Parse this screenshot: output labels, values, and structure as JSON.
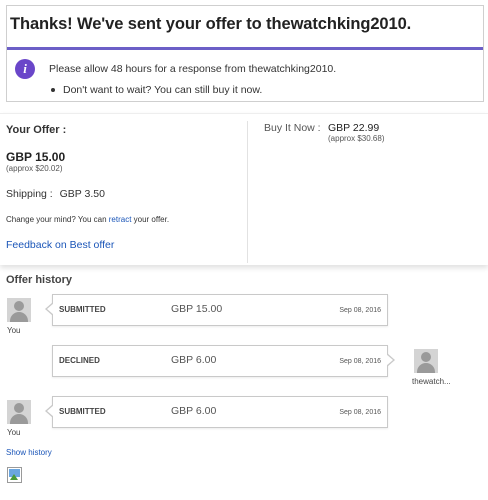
{
  "confirmation": {
    "title": "Thanks! We've sent your offer to thewatchking2010.",
    "info_icon": "info-icon",
    "info_text": "Please allow 48 hours for a response from thewatchking2010.",
    "bullet_text": "Don't want to wait? You can still buy it now."
  },
  "offer": {
    "label": "Your Offer :",
    "price": "GBP 15.00",
    "approx": "(approx $20.02)",
    "shipping_label": "Shipping :",
    "shipping_value": "GBP 3.50",
    "change_prefix": "Change your mind? You can ",
    "change_link": "retract",
    "change_suffix": " your offer.",
    "feedback_link": "Feedback on Best offer"
  },
  "buy_it_now": {
    "label": "Buy It Now :",
    "price": "GBP 22.99",
    "approx": "(approx $30.68)"
  },
  "history": {
    "title": "Offer history",
    "entries": [
      {
        "side": "buyer",
        "user": "You",
        "status": "SUBMITTED",
        "amount": "GBP 15.00",
        "date": "Sep 08, 2016"
      },
      {
        "side": "seller",
        "user": "thewatch...",
        "status": "DECLINED",
        "amount": "GBP 6.00",
        "date": "Sep 08, 2016"
      },
      {
        "side": "buyer",
        "user": "You",
        "status": "SUBMITTED",
        "amount": "GBP 6.00",
        "date": "Sep 08, 2016"
      }
    ],
    "show_history_link": "Show history"
  },
  "colors": {
    "accent_border": "#6c5fc7",
    "info_icon_bg": "#6a46c9",
    "link": "#1a55b8"
  }
}
